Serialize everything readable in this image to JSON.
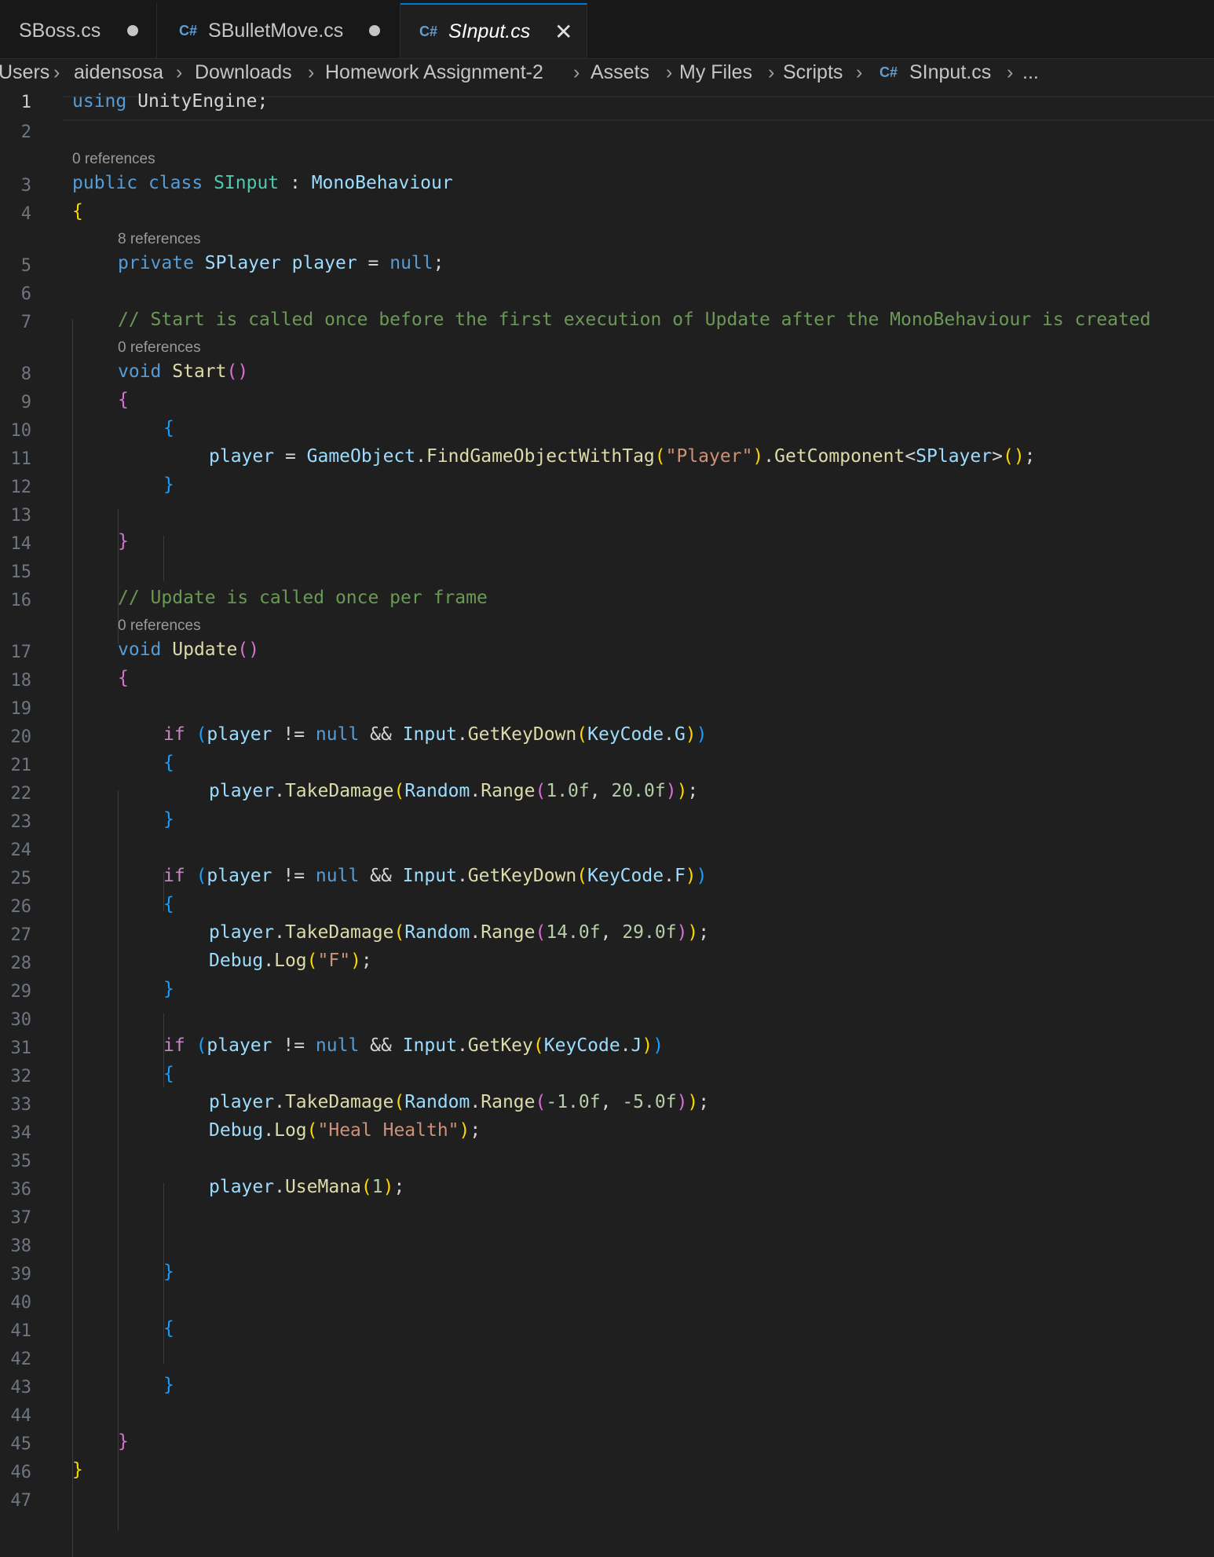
{
  "tabs": [
    {
      "label": "SBoss.cs",
      "modified": true,
      "active": false
    },
    {
      "label": "SBulletMove.cs",
      "modified": true,
      "active": false
    },
    {
      "label": "SInput.cs",
      "modified": false,
      "active": true
    }
  ],
  "tab_icon_glyph": "C#",
  "close_glyph": "✕",
  "breadcrumb": [
    "Users",
    "aidensosa",
    "Downloads",
    "Homework Assignment-2",
    "Assets",
    "My Files",
    "Scripts",
    "SInput.cs",
    "..."
  ],
  "breadcrumb_separator": "›",
  "codelens": {
    "ref0": "0 references",
    "ref8": "8 references"
  },
  "line_numbers": [
    "1",
    "2",
    "3",
    "4",
    "5",
    "6",
    "7",
    "8",
    "9",
    "10",
    "11",
    "12",
    "13",
    "14",
    "15",
    "16",
    "17",
    "18",
    "19",
    "20",
    "21",
    "22",
    "23",
    "24",
    "25",
    "26",
    "27",
    "28",
    "29",
    "30",
    "31",
    "32",
    "33",
    "34",
    "35",
    "36",
    "37",
    "38",
    "39",
    "40",
    "41",
    "42",
    "43",
    "44",
    "45",
    "46",
    "47"
  ],
  "code": {
    "l1": {
      "a": "using",
      "b": "UnityEngine",
      "c": ";"
    },
    "l3": {
      "a": "public",
      "b": "class",
      "c": "SInput",
      "d": " : ",
      "e": "MonoBehaviour"
    },
    "l4": {
      "a": "{"
    },
    "l5": {
      "a": "private",
      "b": "SPlayer",
      "c": "player",
      "d": " = ",
      "e": "null",
      "f": ";"
    },
    "l7": {
      "a": "// Start is called once before the first execution of Update after the MonoBehaviour is created"
    },
    "l8": {
      "a": "void",
      "b": "Start",
      "c": "()"
    },
    "l9": {
      "a": "{"
    },
    "l10": {
      "a": "{"
    },
    "l11": {
      "a": "player",
      "b": " = ",
      "c": "GameObject",
      "d": ".",
      "e": "FindGameObjectWithTag",
      "f": "(",
      "g": "\"Player\"",
      "h": ")",
      "i": ".",
      "j": "GetComponent",
      "k": "<",
      "l": "SPlayer",
      "m": ">",
      "n": "()",
      "o": ";"
    },
    "l12": {
      "a": "}"
    },
    "l14": {
      "a": "}"
    },
    "l16": {
      "a": "// Update is called once per frame"
    },
    "l17": {
      "a": "void",
      "b": "Update",
      "c": "()"
    },
    "l18": {
      "a": "{"
    },
    "l20": {
      "a": "if",
      "b": "(",
      "c": "player",
      "d": " != ",
      "e": "null",
      "f": " && ",
      "g": "Input",
      "h": ".",
      "i": "GetKeyDown",
      "j": "(",
      "k": "KeyCode",
      "l": ".",
      "m": "G",
      "n": ")",
      "o": ")"
    },
    "l21": {
      "a": "{"
    },
    "l22": {
      "a": "player",
      "b": ".",
      "c": "TakeDamage",
      "d": "(",
      "e": "Random",
      "f": ".",
      "g": "Range",
      "h": "(",
      "i": "1.0f",
      "j": ", ",
      "k": "20.0f",
      "l": ")",
      "m": ")",
      "n": ";"
    },
    "l23": {
      "a": "}"
    },
    "l25": {
      "a": "if",
      "b": "(",
      "c": "player",
      "d": " != ",
      "e": "null",
      "f": " && ",
      "g": "Input",
      "h": ".",
      "i": "GetKeyDown",
      "j": "(",
      "k": "KeyCode",
      "l": ".",
      "m": "F",
      "n": ")",
      "o": ")"
    },
    "l26": {
      "a": "{"
    },
    "l27": {
      "a": "player",
      "b": ".",
      "c": "TakeDamage",
      "d": "(",
      "e": "Random",
      "f": ".",
      "g": "Range",
      "h": "(",
      "i": "14.0f",
      "j": ", ",
      "k": "29.0f",
      "l": ")",
      "m": ")",
      "n": ";"
    },
    "l28": {
      "a": "Debug",
      "b": ".",
      "c": "Log",
      "d": "(",
      "e": "\"F\"",
      "f": ")",
      "g": ";"
    },
    "l29": {
      "a": "}"
    },
    "l31": {
      "a": "if",
      "b": "(",
      "c": "player",
      "d": " != ",
      "e": "null",
      "f": " && ",
      "g": "Input",
      "h": ".",
      "i": "GetKey",
      "j": "(",
      "k": "KeyCode",
      "l": ".",
      "m": "J",
      "n": ")",
      "o": ")"
    },
    "l32": {
      "a": "{"
    },
    "l33": {
      "a": "player",
      "b": ".",
      "c": "TakeDamage",
      "d": "(",
      "e": "Random",
      "f": ".",
      "g": "Range",
      "h": "(",
      "i": "-1.0f",
      "j": ", ",
      "k": "-5.0f",
      "l": ")",
      "m": ")",
      "n": ";"
    },
    "l34": {
      "a": "Debug",
      "b": ".",
      "c": "Log",
      "d": "(",
      "e": "\"Heal Health\"",
      "f": ")",
      "g": ";"
    },
    "l36": {
      "a": "player",
      "b": ".",
      "c": "UseMana",
      "d": "(",
      "e": "1",
      "f": ")",
      "g": ";"
    },
    "l39": {
      "a": "}"
    },
    "l41": {
      "a": "{"
    },
    "l43": {
      "a": "}"
    },
    "l45": {
      "a": "}"
    },
    "l46": {
      "a": "}"
    }
  }
}
